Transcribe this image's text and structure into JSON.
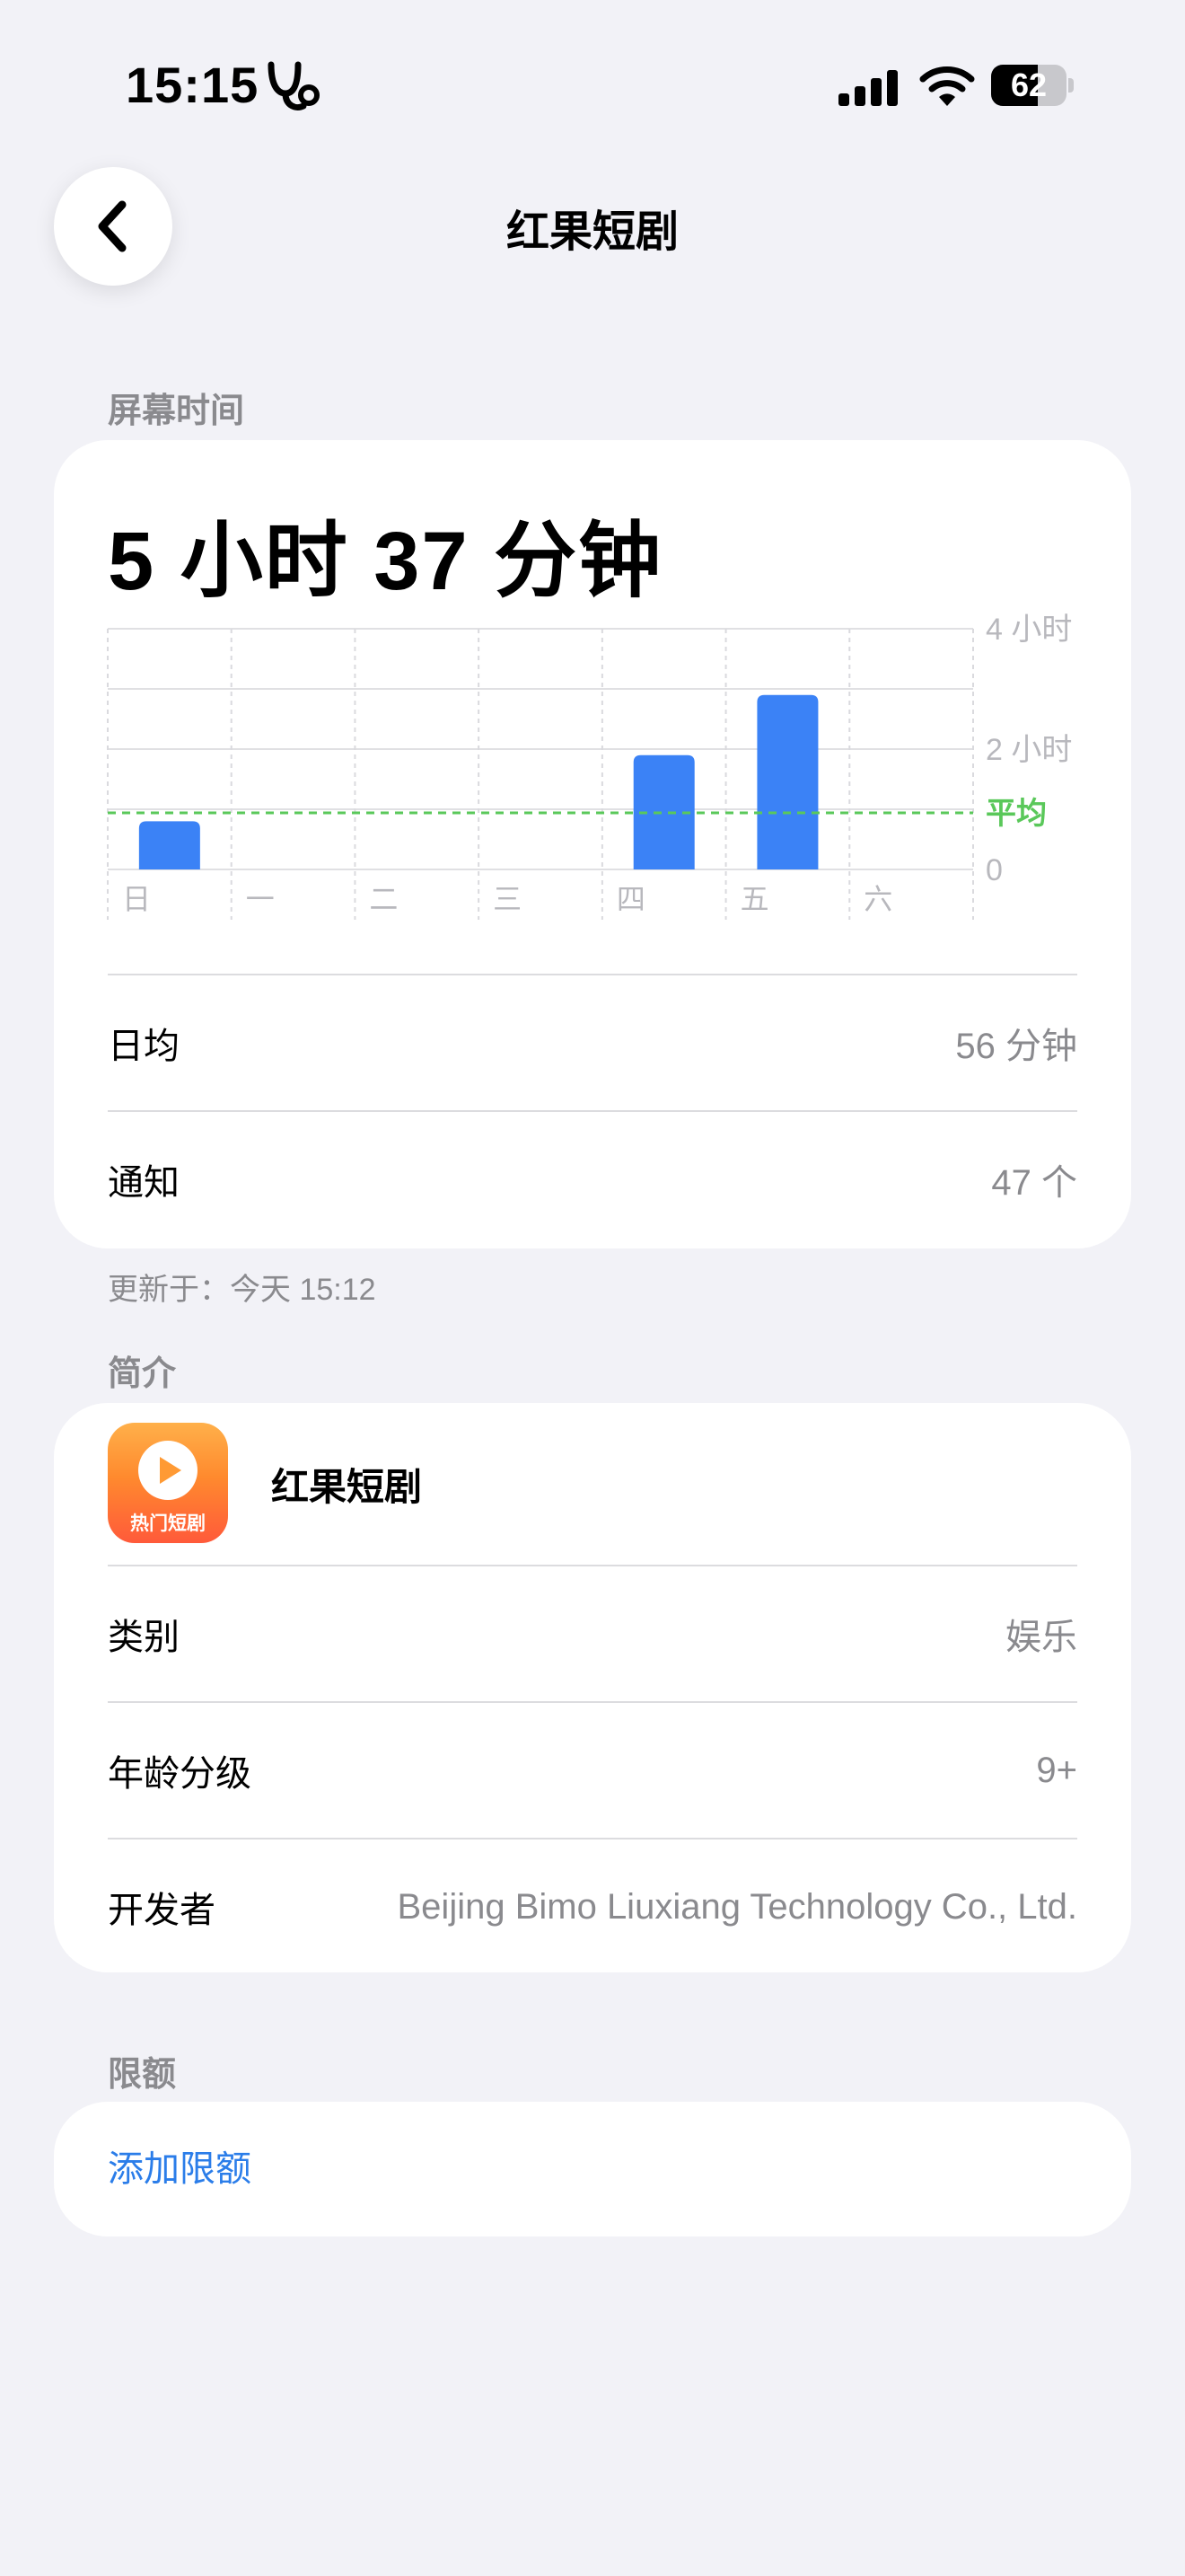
{
  "status_bar": {
    "time": "15:15",
    "battery_percent": "62",
    "battery_level": 0.62
  },
  "nav": {
    "title": "红果短剧",
    "back_icon": "chevron-left-icon"
  },
  "screen_time": {
    "section_title": "屏幕时间",
    "total": "5 小时 37 分钟",
    "daily_avg_label": "日均",
    "daily_avg_value": "56 分钟",
    "notifications_label": "通知",
    "notifications_value": "47 个",
    "updated": "更新于：今天 15:12"
  },
  "chart_data": {
    "type": "bar",
    "categories": [
      "日",
      "一",
      "二",
      "三",
      "四",
      "五",
      "六"
    ],
    "values": [
      0.8,
      0,
      0,
      0,
      1.9,
      2.9,
      0
    ],
    "y_ticks": [
      {
        "value": 4,
        "label": "4 小时"
      },
      {
        "value": 2,
        "label": "2 小时"
      },
      {
        "value": 0,
        "label": "0"
      }
    ],
    "average": {
      "value": 0.94,
      "label": "平均"
    },
    "ylim": [
      0,
      4
    ],
    "unit": "hours",
    "bar_color": "#3b82f6",
    "average_color": "#5ac85a",
    "grid": true
  },
  "intro": {
    "section_title": "简介",
    "app_name": "红果短剧",
    "icon_caption": "热门短剧",
    "category_label": "类别",
    "category_value": "娱乐",
    "age_label": "年龄分级",
    "age_value": "9+",
    "developer_label": "开发者",
    "developer_value": "Beijing Bimo Liuxiang Technology Co., Ltd."
  },
  "limits": {
    "section_title": "限额",
    "add_label": "添加限额"
  },
  "colors": {
    "background": "#f2f2f7",
    "accent": "#2b7de9",
    "secondary_text": "#8a8a8e"
  }
}
